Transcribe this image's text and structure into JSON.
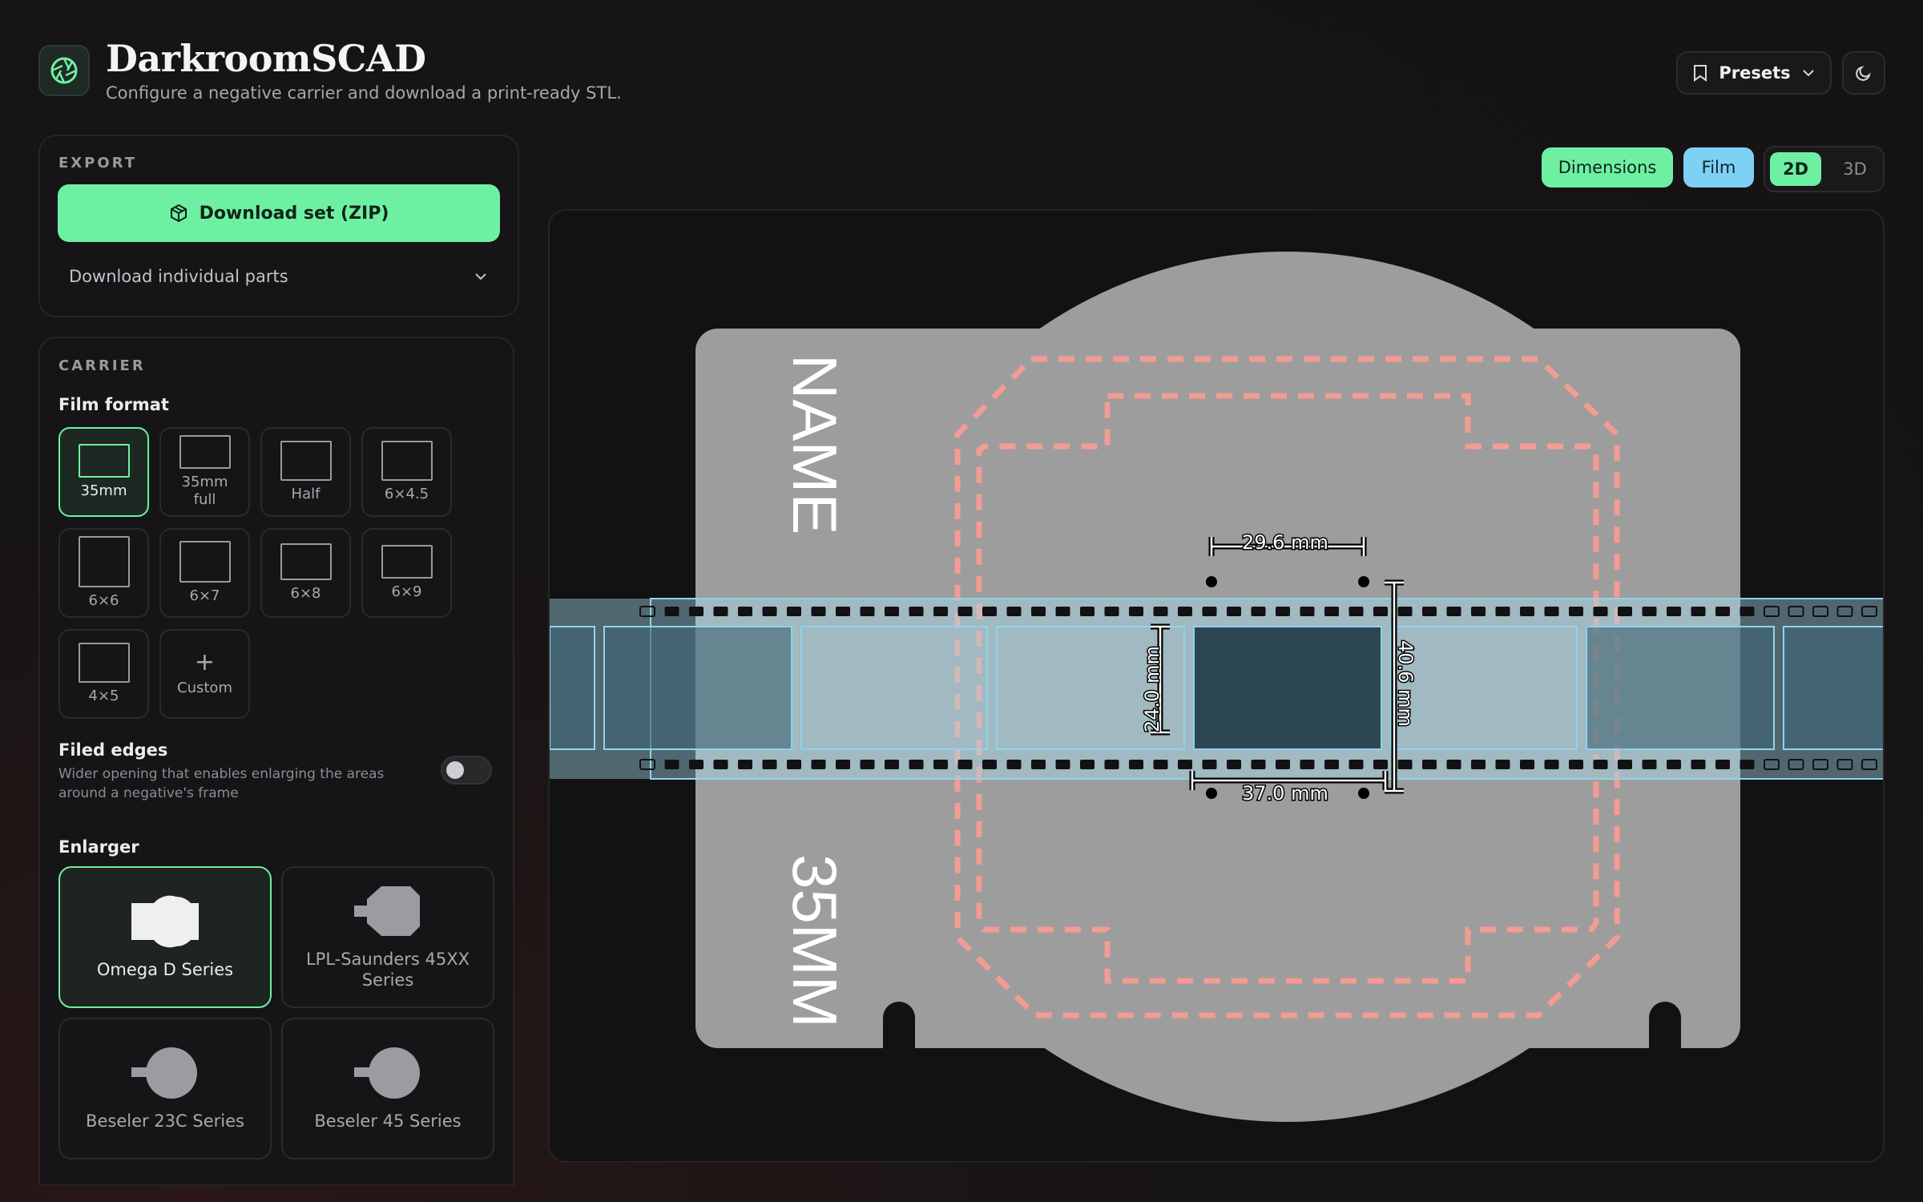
{
  "header": {
    "title": "DarkroomSCAD",
    "subtitle": "Configure a negative carrier and download a print-ready STL.",
    "presets_label": "Presets"
  },
  "export": {
    "section_label": "EXPORT",
    "download_zip_label": "Download set (ZIP)",
    "download_parts_label": "Download individual parts"
  },
  "carrier": {
    "section_label": "CARRIER",
    "film_format_label": "Film format",
    "formats": [
      {
        "label": "35mm",
        "selected": true
      },
      {
        "label": "35mm full",
        "selected": false
      },
      {
        "label": "Half",
        "selected": false
      },
      {
        "label": "6×4.5",
        "selected": false
      },
      {
        "label": "6×6",
        "selected": false
      },
      {
        "label": "6×7",
        "selected": false
      },
      {
        "label": "6×8",
        "selected": false
      },
      {
        "label": "6×9",
        "selected": false
      },
      {
        "label": "4×5",
        "selected": false
      },
      {
        "label": "Custom",
        "selected": false
      }
    ],
    "custom_plus": "+",
    "filed_edges_label": "Filed edges",
    "filed_edges_help": "Wider opening that enables enlarging the areas around a negative's frame",
    "filed_edges_on": false,
    "enlarger_label": "Enlarger",
    "enlargers": [
      {
        "label": "Omega D Series",
        "selected": true
      },
      {
        "label": "LPL-Saunders 45XX Series",
        "selected": false
      },
      {
        "label": "Beseler 23C Series",
        "selected": false
      },
      {
        "label": "Beseler 45 Series",
        "selected": false
      }
    ]
  },
  "toolbar": {
    "dimensions_label": "Dimensions",
    "film_label": "Film",
    "view_2d_label": "2D",
    "view_3d_label": "3D"
  },
  "preview": {
    "carrier_text_top": "NAME",
    "carrier_text_bottom": "35MM",
    "dim_width_top": "29.6 mm",
    "dim_width_bottom": "37.0 mm",
    "dim_height_left": "24.0 mm",
    "dim_height_right": "40.6 mm"
  },
  "colors": {
    "accent_green": "#6ef0a3",
    "accent_blue": "#7fd0f5",
    "carrier_gray": "#9d9d9d",
    "outline_salmon": "#f29c93",
    "film_blue": "#a8dff0"
  }
}
